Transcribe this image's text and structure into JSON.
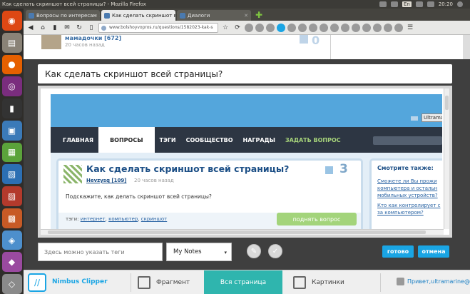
{
  "top_panel": {
    "window_title": "Как сделать скриншот всей страницы? - Mozilla Firefox",
    "lang": "En",
    "clock": "20:20"
  },
  "launcher": {
    "icons": [
      "ubuntu-home-icon",
      "files-icon",
      "firefox-icon",
      "eye-icon",
      "terminal-icon",
      "app-icon-1",
      "app-icon-2",
      "app-icon-3",
      "app-icon-4",
      "app-icon-5",
      "app-icon-6",
      "app-icon-7",
      "app-icon-8",
      "app-icon-9"
    ]
  },
  "browser": {
    "tabs": [
      {
        "label": "Вопросы по интересам",
        "active": false
      },
      {
        "label": "Как сделать скриншот все...",
        "active": true
      },
      {
        "label": "Диалоги",
        "active": false
      }
    ],
    "url": "www.bolshoyvopros.ru/questions/1582023-kak-s"
  },
  "page_behind": {
    "user": "мамадочки [672]",
    "time": "20 часов назад",
    "votes": "0"
  },
  "overlay": {
    "title": "Как сделать скриншот всей страницы?",
    "preview": {
      "login": "Ultrama",
      "menu": [
        "ГЛАВНАЯ",
        "ВОПРОСЫ",
        "ТЭГИ",
        "СООБЩЕСТВО",
        "НАГРАДЫ",
        "ЗАДАТЬ ВОПРОС"
      ],
      "question_title": "Как сделать скриншот всей страницы?",
      "author": "Hevzysq [109]",
      "time": "20 часов назад",
      "votes": "3",
      "body": "Подскажите, как делать скриншот всей страницы?",
      "tags_label": "тэги:",
      "tags": [
        "интернет",
        "компьютер",
        "скриншот"
      ],
      "raise_button": "поднять вопрос",
      "sidebar_title": "Смотрите также:",
      "sidebar_links": [
        "Сможете ли Вы прожи",
        "компьютера и остальн",
        "мобильных устройств?",
        "Кто как контролирует с",
        "за компьютером?"
      ]
    },
    "tags_input_placeholder": "Здесь можно указать теги",
    "notes_select": "My Notes",
    "done_button": "готово",
    "cancel_button": "отмена"
  },
  "nimbus": {
    "brand": "Nimbus Clipper",
    "tabs": [
      {
        "label": "Фрагмент",
        "active": false
      },
      {
        "label": "Вся страница",
        "active": true
      },
      {
        "label": "Картинки",
        "active": false
      }
    ],
    "user": "Привет,ultramarine@mai..."
  }
}
